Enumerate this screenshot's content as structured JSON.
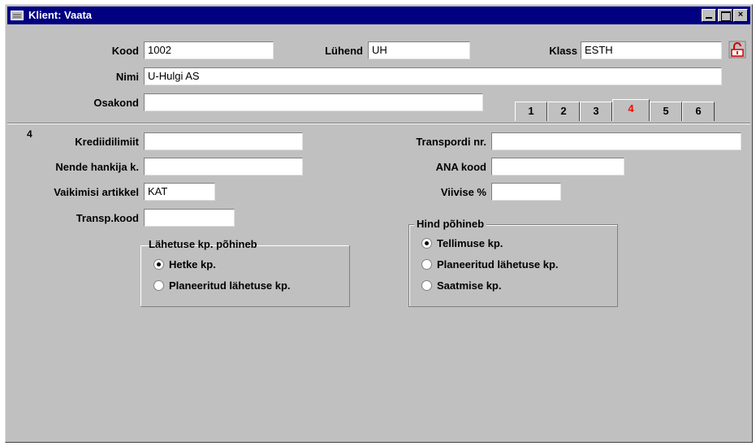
{
  "window": {
    "title": "Klient: Vaata"
  },
  "header": {
    "kood_label": "Kood",
    "kood_value": "1002",
    "luhend_label": "Lühend",
    "luhend_value": "UH",
    "klass_label": "Klass",
    "klass_value": "ESTH",
    "nimi_label": "Nimi",
    "nimi_value": "U-Hulgi AS",
    "osakond_label": "Osakond",
    "osakond_value": ""
  },
  "tabs": [
    "1",
    "2",
    "3",
    "4",
    "5",
    "6"
  ],
  "active_tab": "4",
  "page_number": "4",
  "left": {
    "krediidilimiit_label": "Krediidilimiit",
    "krediidilimiit_value": "",
    "hankija_label": "Nende hankija k.",
    "hankija_value": "",
    "artikkel_label": "Vaikimisi artikkel",
    "artikkel_value": "KAT",
    "transp_label": "Transp.kood",
    "transp_value": ""
  },
  "right": {
    "transpordi_label": "Transpordi nr.",
    "transpordi_value": "",
    "ana_label": "ANA kood",
    "ana_value": "",
    "viivise_label": "Viivise %",
    "viivise_value": ""
  },
  "group_lahetus": {
    "title": "Lähetuse kp. põhineb",
    "options": [
      "Hetke kp.",
      "Planeeritud lähetuse kp."
    ],
    "selected": 0
  },
  "group_hind": {
    "title": "Hind põhineb",
    "options": [
      "Tellimuse kp.",
      "Planeeritud lähetuse kp.",
      "Saatmise kp."
    ],
    "selected": 0
  },
  "colors": {
    "titlebar": "#000080",
    "active_tab": "#ff0000",
    "face": "#c0c0c0"
  }
}
